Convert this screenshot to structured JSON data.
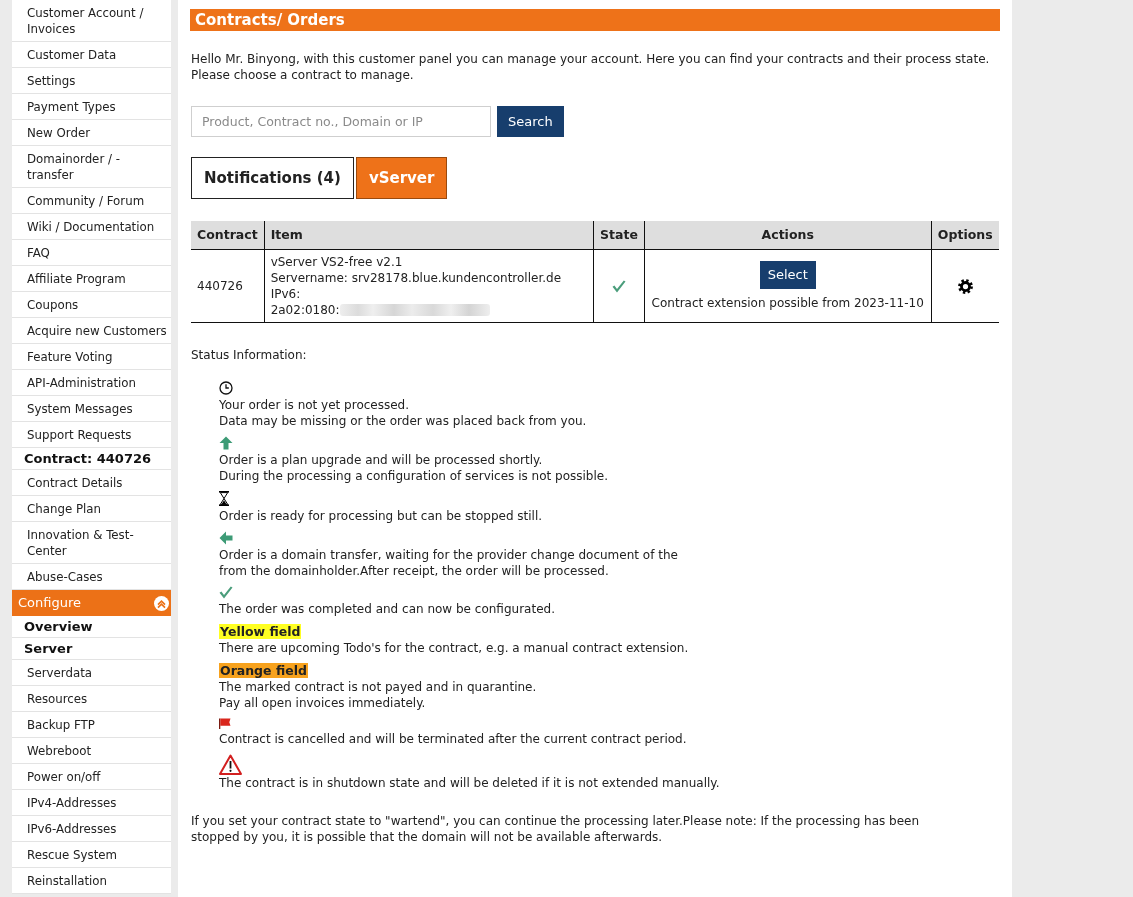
{
  "sidebar": {
    "items": [
      {
        "kind": "link",
        "label": "Customer Account / Invoices"
      },
      {
        "kind": "link",
        "label": "Customer Data"
      },
      {
        "kind": "link",
        "label": "Settings"
      },
      {
        "kind": "link",
        "label": "Payment Types"
      },
      {
        "kind": "link",
        "label": "New Order"
      },
      {
        "kind": "link",
        "label": "Domainorder / - transfer"
      },
      {
        "kind": "link",
        "label": "Community / Forum"
      },
      {
        "kind": "link",
        "label": "Wiki / Documentation"
      },
      {
        "kind": "link",
        "label": "FAQ"
      },
      {
        "kind": "link",
        "label": "Affiliate Program"
      },
      {
        "kind": "link",
        "label": "Coupons"
      },
      {
        "kind": "link",
        "label": "Acquire new Customers"
      },
      {
        "kind": "link",
        "label": "Feature Voting"
      },
      {
        "kind": "link",
        "label": "API-Administration"
      },
      {
        "kind": "link",
        "label": "System Messages"
      },
      {
        "kind": "link",
        "label": "Support Requests"
      },
      {
        "kind": "heading",
        "label": "Contract: 440726"
      },
      {
        "kind": "link",
        "label": "Contract Details"
      },
      {
        "kind": "link",
        "label": "Change Plan"
      },
      {
        "kind": "link",
        "label": "Innovation & Test-Center"
      },
      {
        "kind": "link",
        "label": "Abuse-Cases"
      },
      {
        "kind": "section",
        "label": "Configure",
        "expanded": true
      },
      {
        "kind": "heading",
        "label": "Overview"
      },
      {
        "kind": "heading",
        "label": "Server"
      },
      {
        "kind": "link",
        "label": "Serverdata"
      },
      {
        "kind": "link",
        "label": "Resources"
      },
      {
        "kind": "link",
        "label": "Backup FTP"
      },
      {
        "kind": "link",
        "label": "Webreboot"
      },
      {
        "kind": "link",
        "label": "Power on/off"
      },
      {
        "kind": "link",
        "label": "IPv4-Addresses"
      },
      {
        "kind": "link",
        "label": "IPv6-Addresses"
      },
      {
        "kind": "link",
        "label": "Rescue System"
      },
      {
        "kind": "link",
        "label": "Reinstallation"
      }
    ]
  },
  "main": {
    "title": "Contracts/ Orders",
    "intro": "Hello Mr. Binyong, with this customer panel you can manage your account. Here you can find your contracts and their process state. Please choose a contract to manage.",
    "search": {
      "placeholder": "Product, Contract no., Domain or IP",
      "button": "Search"
    },
    "tabs": [
      {
        "label": "Notifications (4)",
        "selected": false
      },
      {
        "label": "vServer",
        "selected": true
      }
    ],
    "table": {
      "columns": [
        "Contract",
        "Item",
        "State",
        "Actions",
        "Options"
      ],
      "rows": [
        {
          "contract": "440726",
          "item_lines": [
            "vServer VS2-free v2.1",
            "Servername: srv28178.blue.kundencontroller.de",
            "IPv6:",
            "2a02:0180:"
          ],
          "ipv6_redacted": true,
          "state": {
            "kind": "completed"
          },
          "action_button": "Select",
          "action_note": "Contract extension possible from 2023-11-10"
        }
      ]
    },
    "status": {
      "heading": "Status Information:",
      "items": [
        {
          "kind": "pending",
          "lines": [
            "Your order is not yet processed.",
            "Data may be missing or the order was placed back from you."
          ]
        },
        {
          "kind": "upgrade",
          "lines": [
            "Order is a plan upgrade and will be processed shortly.",
            "During the processing a configuration of services is not possible."
          ]
        },
        {
          "kind": "ready",
          "lines": [
            "Order is ready for processing but can be stopped still."
          ]
        },
        {
          "kind": "transfer",
          "lines": [
            "Order is a domain transfer, waiting for the provider change document of the",
            "from the domainholder.After receipt, the order will be processed."
          ]
        },
        {
          "kind": "completed",
          "lines": [
            "The order was completed and can now be configurated."
          ]
        },
        {
          "kind": "highlight",
          "label": "Yellow field",
          "color": "#ffff22",
          "lines": [
            "There are upcoming Todo's for the contract, e.g. a manual contract extension."
          ]
        },
        {
          "kind": "highlight",
          "label": "Orange field",
          "color": "#f7a21e",
          "lines": [
            "The marked contract is not payed and in quarantine.",
            "Pay all open invoices immediately."
          ]
        },
        {
          "kind": "cancelled",
          "lines": [
            "Contract is cancelled and will be terminated after the current contract period."
          ]
        },
        {
          "kind": "shutdown",
          "lines": [
            "The contract is in shutdown state and will be deleted if it is not extended manually."
          ]
        }
      ]
    },
    "footer": "If you set your contract state to \"wartend\", you can continue the processing later.Please note: If the processing has been stopped by you, it is possible that the domain will not be available afterwards."
  }
}
